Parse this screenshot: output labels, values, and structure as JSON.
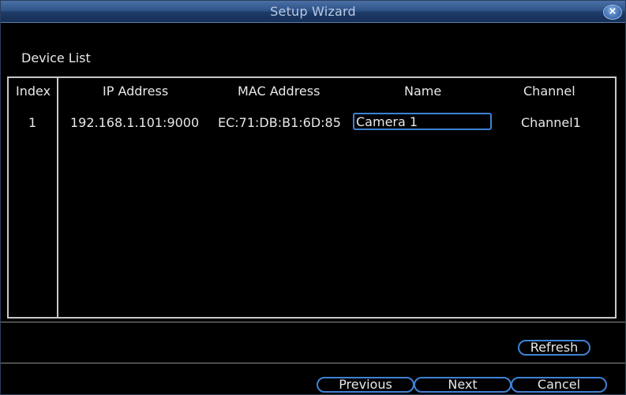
{
  "window": {
    "title": "Setup Wizard",
    "close_glyph": "×"
  },
  "section": {
    "label": "Device List"
  },
  "table": {
    "headers": {
      "index": "Index",
      "ip": "IP Address",
      "mac": "MAC Address",
      "name": "Name",
      "channel": "Channel"
    },
    "rows": [
      {
        "index": "1",
        "ip": "192.168.1.101:9000",
        "mac": "EC:71:DB:B1:6D:85",
        "name": "Camera 1",
        "channel": "Channel1"
      }
    ]
  },
  "buttons": {
    "refresh": "Refresh",
    "previous": "Previous",
    "next": "Next",
    "cancel": "Cancel"
  },
  "colors": {
    "titlebar": "#2f5488",
    "accent_border": "#3f82d4",
    "background": "#000000",
    "text": "#e8e8e8"
  },
  "icons": {
    "close": "close-icon"
  }
}
